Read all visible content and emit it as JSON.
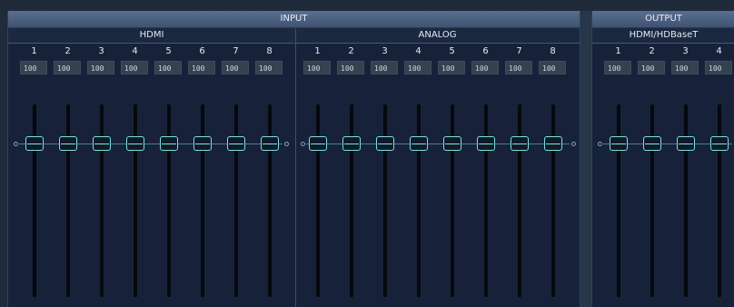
{
  "input": {
    "title": "INPUT",
    "sections": [
      {
        "label": "HDMI",
        "channels": [
          {
            "num": "1",
            "value": "100"
          },
          {
            "num": "2",
            "value": "100"
          },
          {
            "num": "3",
            "value": "100"
          },
          {
            "num": "4",
            "value": "100"
          },
          {
            "num": "5",
            "value": "100"
          },
          {
            "num": "6",
            "value": "100"
          },
          {
            "num": "7",
            "value": "100"
          },
          {
            "num": "8",
            "value": "100"
          }
        ]
      },
      {
        "label": "ANALOG",
        "channels": [
          {
            "num": "1",
            "value": "100"
          },
          {
            "num": "2",
            "value": "100"
          },
          {
            "num": "3",
            "value": "100"
          },
          {
            "num": "4",
            "value": "100"
          },
          {
            "num": "5",
            "value": "100"
          },
          {
            "num": "6",
            "value": "100"
          },
          {
            "num": "7",
            "value": "100"
          },
          {
            "num": "8",
            "value": "100"
          }
        ]
      }
    ]
  },
  "output": {
    "title": "OUTPUT",
    "sections": [
      {
        "label": "HDMI/HDBaseT",
        "channels": [
          {
            "num": "1",
            "value": "100"
          },
          {
            "num": "2",
            "value": "100"
          },
          {
            "num": "3",
            "value": "100"
          },
          {
            "num": "4",
            "value": "100"
          }
        ]
      }
    ]
  },
  "colors": {
    "background": "#1f2a3a",
    "header": "#4b6080",
    "fader_accent": "#7fe0d6",
    "track": "#05080d"
  },
  "icons": {
    "fader_knob": "fader-knob-icon",
    "unity_marker": "unity-marker-icon"
  }
}
